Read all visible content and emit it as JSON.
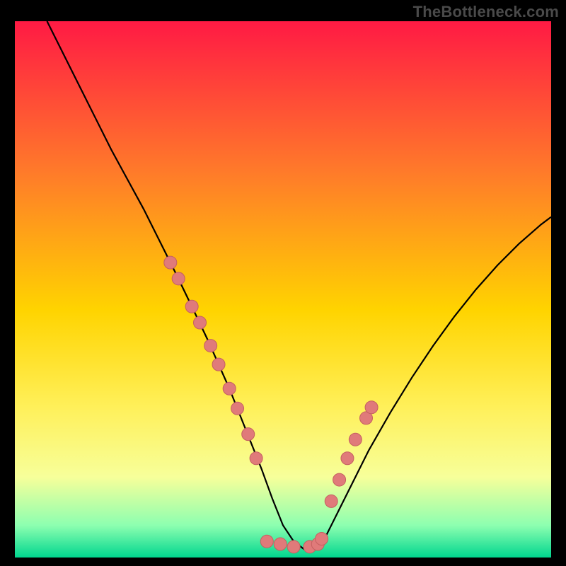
{
  "watermark": "TheBottleneck.com",
  "palette": {
    "frame_bg": "#000000",
    "gradient_top": "#ff1a44",
    "gradient_mid1": "#ff7a2a",
    "gradient_mid2": "#ffd400",
    "gradient_mid3": "#fff05a",
    "gradient_mid4": "#f7ff9a",
    "gradient_bottom1": "#8dffb0",
    "gradient_bottom2": "#00d68f",
    "curve": "#000000",
    "bead_fill": "#e07a7a",
    "bead_stroke": "#c46060"
  },
  "chart_data": {
    "type": "line",
    "title": "",
    "xlabel": "",
    "ylabel": "",
    "xlim": [
      0,
      100
    ],
    "ylim": [
      0,
      100
    ],
    "series": [
      {
        "name": "curve",
        "x": [
          6,
          9,
          12,
          15,
          18,
          21,
          24,
          27,
          30,
          33,
          36,
          38,
          40,
          42,
          44,
          46,
          48,
          50,
          52,
          54,
          56,
          58,
          60,
          63,
          66,
          70,
          74,
          78,
          82,
          86,
          90,
          94,
          98,
          100
        ],
        "y": [
          100,
          94,
          88,
          82,
          76,
          70.5,
          65,
          59,
          53,
          46.8,
          40.5,
          36,
          31.5,
          26.5,
          21.5,
          16.5,
          11,
          6,
          3,
          1.5,
          1.5,
          4,
          8,
          14,
          20,
          27,
          33.5,
          39.5,
          45,
          50,
          54.5,
          58.5,
          62,
          63.5
        ]
      }
    ],
    "beads": {
      "left_arm": {
        "x_range": [
          29,
          45
        ],
        "count_approx": 10
      },
      "right_arm": {
        "x_range": [
          57,
          67
        ],
        "count_approx": 8
      },
      "valley_floor": {
        "x_range": [
          46,
          56
        ],
        "count_approx": 4
      }
    },
    "beads_points": [
      {
        "x": 29.0,
        "y": 55.0
      },
      {
        "x": 30.5,
        "y": 52.0
      },
      {
        "x": 33.0,
        "y": 46.8
      },
      {
        "x": 34.5,
        "y": 43.8
      },
      {
        "x": 36.5,
        "y": 39.5
      },
      {
        "x": 38.0,
        "y": 36.0
      },
      {
        "x": 40.0,
        "y": 31.5
      },
      {
        "x": 41.5,
        "y": 27.8
      },
      {
        "x": 43.5,
        "y": 23.0
      },
      {
        "x": 45.0,
        "y": 18.5
      },
      {
        "x": 47.0,
        "y": 3.0
      },
      {
        "x": 49.5,
        "y": 2.5
      },
      {
        "x": 52.0,
        "y": 2.0
      },
      {
        "x": 55.0,
        "y": 2.0
      },
      {
        "x": 56.5,
        "y": 2.5
      },
      {
        "x": 57.2,
        "y": 3.5
      },
      {
        "x": 59.0,
        "y": 10.5
      },
      {
        "x": 60.5,
        "y": 14.5
      },
      {
        "x": 62.0,
        "y": 18.5
      },
      {
        "x": 63.5,
        "y": 22.0
      },
      {
        "x": 65.5,
        "y": 26.0
      },
      {
        "x": 66.5,
        "y": 28.0
      }
    ]
  }
}
